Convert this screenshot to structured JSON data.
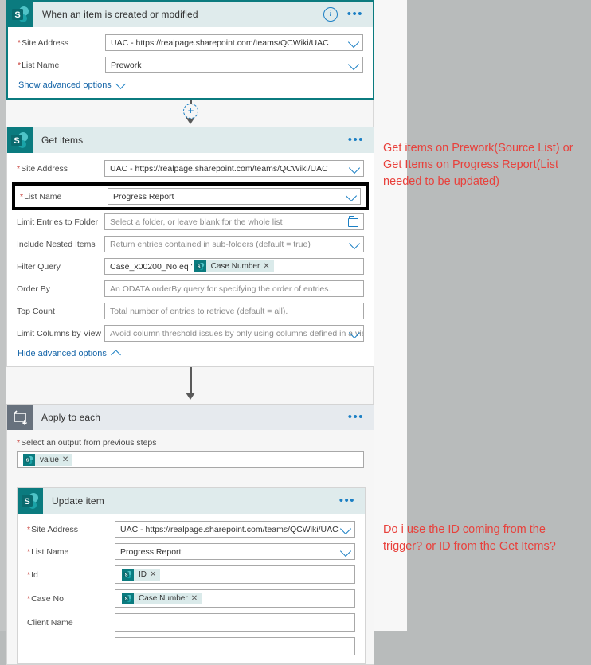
{
  "colors": {
    "accent_teal": "#0b7b7f",
    "header_teal": "#dfebec",
    "link_blue": "#1565a8",
    "annotation_red": "#e8413c",
    "loop_gray": "#67717d",
    "canvas": "#f6f6f6",
    "page_gray": "#b8bbbb",
    "highlight_black": "#000000"
  },
  "trigger": {
    "title": "When an item is created or modified",
    "icon": "sharepoint-icon",
    "info_icon": "info-icon",
    "menu_icon": "ellipsis-icon",
    "fields": [
      {
        "label": "Site Address",
        "required": true,
        "value": "UAC - https://realpage.sharepoint.com/teams/QCWiki/UAC",
        "control": "dropdown"
      },
      {
        "label": "List Name",
        "required": true,
        "value": "Prework",
        "control": "dropdown"
      }
    ],
    "advanced_link": "Show advanced options"
  },
  "connector_1": {
    "plus_label": "+"
  },
  "get_items": {
    "title": "Get items",
    "icon": "sharepoint-icon",
    "menu_icon": "ellipsis-icon",
    "fields": [
      {
        "label": "Site Address",
        "required": true,
        "value": "UAC - https://realpage.sharepoint.com/teams/QCWiki/UAC",
        "control": "dropdown",
        "highlighted": false
      },
      {
        "label": "List Name",
        "required": true,
        "value": "Progress Report",
        "control": "dropdown",
        "highlighted": true
      },
      {
        "label": "Limit Entries to Folder",
        "required": false,
        "placeholder": "Select a folder, or leave blank for the whole list",
        "control": "folder-picker",
        "highlighted": false
      },
      {
        "label": "Include Nested Items",
        "required": false,
        "value": "Return entries contained in sub-folders (default = true)",
        "control": "dropdown",
        "highlighted": false
      },
      {
        "label": "Filter Query",
        "required": false,
        "value": "Case_x00200_No eq '",
        "chip": "Case Number",
        "control": "text-with-token",
        "highlighted": false
      },
      {
        "label": "Order By",
        "required": false,
        "placeholder": "An ODATA orderBy query for specifying the order of entries.",
        "control": "text",
        "highlighted": false
      },
      {
        "label": "Top Count",
        "required": false,
        "placeholder": "Total number of entries to retrieve (default = all).",
        "control": "text",
        "highlighted": false
      },
      {
        "label": "Limit Columns by View",
        "required": false,
        "placeholder": "Avoid column threshold issues by only using columns defined in a view",
        "control": "dropdown",
        "highlighted": false
      }
    ],
    "advanced_link": "Hide advanced options"
  },
  "apply_to_each": {
    "title": "Apply to each",
    "icon": "loop-icon",
    "menu_icon": "ellipsis-icon",
    "select_output_label": "Select an output from previous steps",
    "select_output_required": true,
    "token": "value"
  },
  "update_item": {
    "title": "Update item",
    "icon": "sharepoint-icon",
    "menu_icon": "ellipsis-icon",
    "fields": [
      {
        "label": "Site Address",
        "required": true,
        "value": "UAC - https://realpage.sharepoint.com/teams/QCWiki/UAC",
        "control": "dropdown"
      },
      {
        "label": "List Name",
        "required": true,
        "value": "Progress Report",
        "control": "dropdown"
      },
      {
        "label": "Id",
        "required": true,
        "chip": "ID",
        "control": "token"
      },
      {
        "label": "Case No",
        "required": true,
        "chip": "Case Number",
        "control": "token"
      },
      {
        "label": "Client Name",
        "required": false,
        "value": "",
        "control": "text"
      }
    ]
  },
  "annotations": {
    "get_items_note": "Get items on Prework(Source List) or Get Items on Progress Report(List needed to be updated)",
    "update_item_note": "Do i use the ID coming from the trigger? or ID from the Get Items?"
  }
}
